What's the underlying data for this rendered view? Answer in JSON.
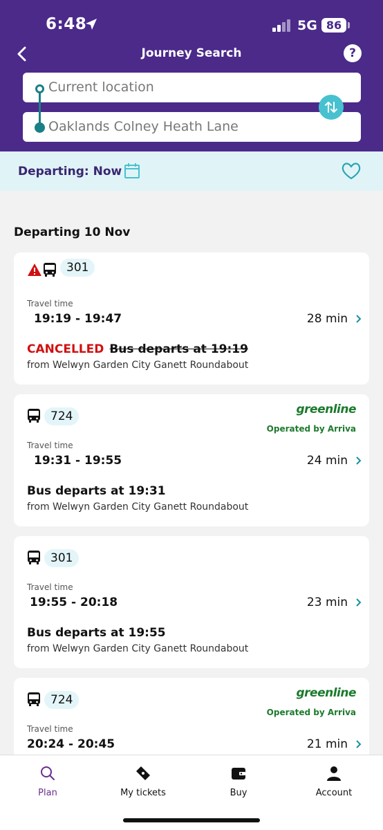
{
  "status": {
    "time": "6:48",
    "network": "5G",
    "battery": "86"
  },
  "header": {
    "title": "Journey Search"
  },
  "search": {
    "from": "Current location",
    "to": "Oaklands Colney Heath Lane"
  },
  "departing": {
    "label": "Departing: Now"
  },
  "section_title": "Departing 10 Nov",
  "travel_time_label": "Travel time",
  "journeys": [
    {
      "route": "301",
      "alert": true,
      "times": "19:19 - 19:47",
      "duration": "28 min",
      "status": "CANCELLED",
      "departs": "Bus departs at 19:19",
      "from": "from Welwyn Garden City Ganett Roundabout"
    },
    {
      "route": "724",
      "operator_logo": "greenline",
      "operator": "Operated by Arriva",
      "times": "19:31 - 19:55",
      "duration": "24 min",
      "departs": "Bus departs at 19:31",
      "from": "from Welwyn Garden City Ganett Roundabout"
    },
    {
      "route": "301",
      "times": "19:55 - 20:18",
      "duration": "23 min",
      "departs": "Bus departs at 19:55",
      "from": "from Welwyn Garden City Ganett Roundabout"
    },
    {
      "route": "724",
      "operator_logo": "greenline",
      "operator": "Operated by Arriva",
      "times": "20:24 - 20:45",
      "duration": "21 min"
    }
  ],
  "tabs": [
    {
      "label": "Plan",
      "icon": "search-icon",
      "active": true
    },
    {
      "label": "My tickets",
      "icon": "ticket-icon"
    },
    {
      "label": "Buy",
      "icon": "wallet-icon"
    },
    {
      "label": "Account",
      "icon": "person-icon"
    }
  ],
  "colors": {
    "header": "#4b2a8a",
    "accent": "#47c1cf",
    "cancelled": "#d01010",
    "operator": "#1e7a2e",
    "tab_active": "#6b2c8f"
  }
}
